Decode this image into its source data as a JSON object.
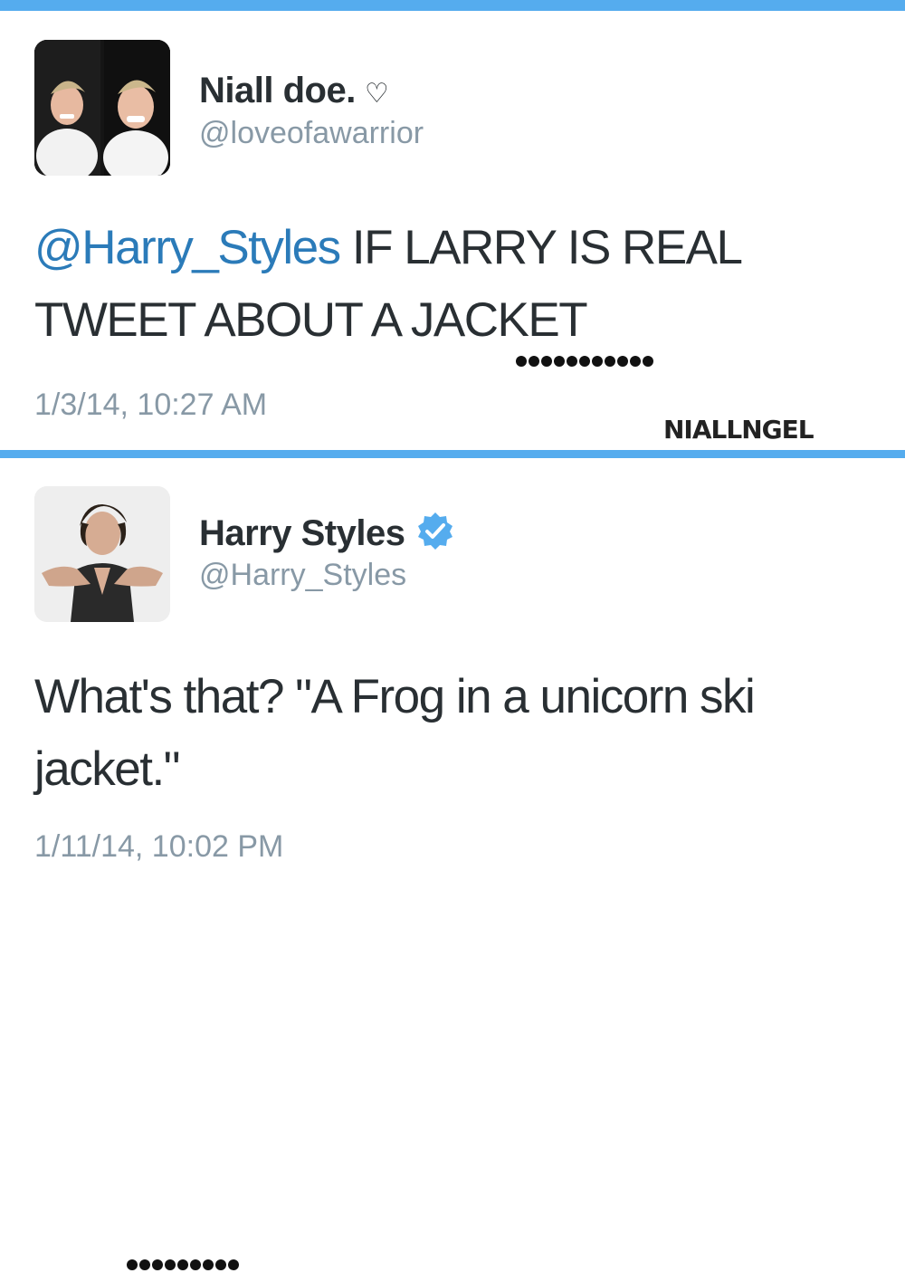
{
  "tweets": [
    {
      "name": "Niall doe.",
      "name_suffix": "♡",
      "handle": "@loveofawarrior",
      "mention": "@Harry_Styles",
      "text": " IF LARRY IS REAL TWEET ABOUT A JACKET",
      "timestamp": "1/3/14, 10:27 AM",
      "avatar_icon": "profile-photo-icon"
    },
    {
      "name": "Harry Styles",
      "verified": true,
      "handle": "@Harry_Styles",
      "text": "What's that? \"A Frog in a unicorn ski jacket.\"",
      "timestamp": "1/11/14, 10:02 PM",
      "avatar_icon": "profile-photo-icon"
    }
  ],
  "watermark": "NIALLNGEL",
  "colors": {
    "accent": "#55acee",
    "link": "#2b7bb9",
    "muted": "#8899a6",
    "text": "#292f33"
  }
}
